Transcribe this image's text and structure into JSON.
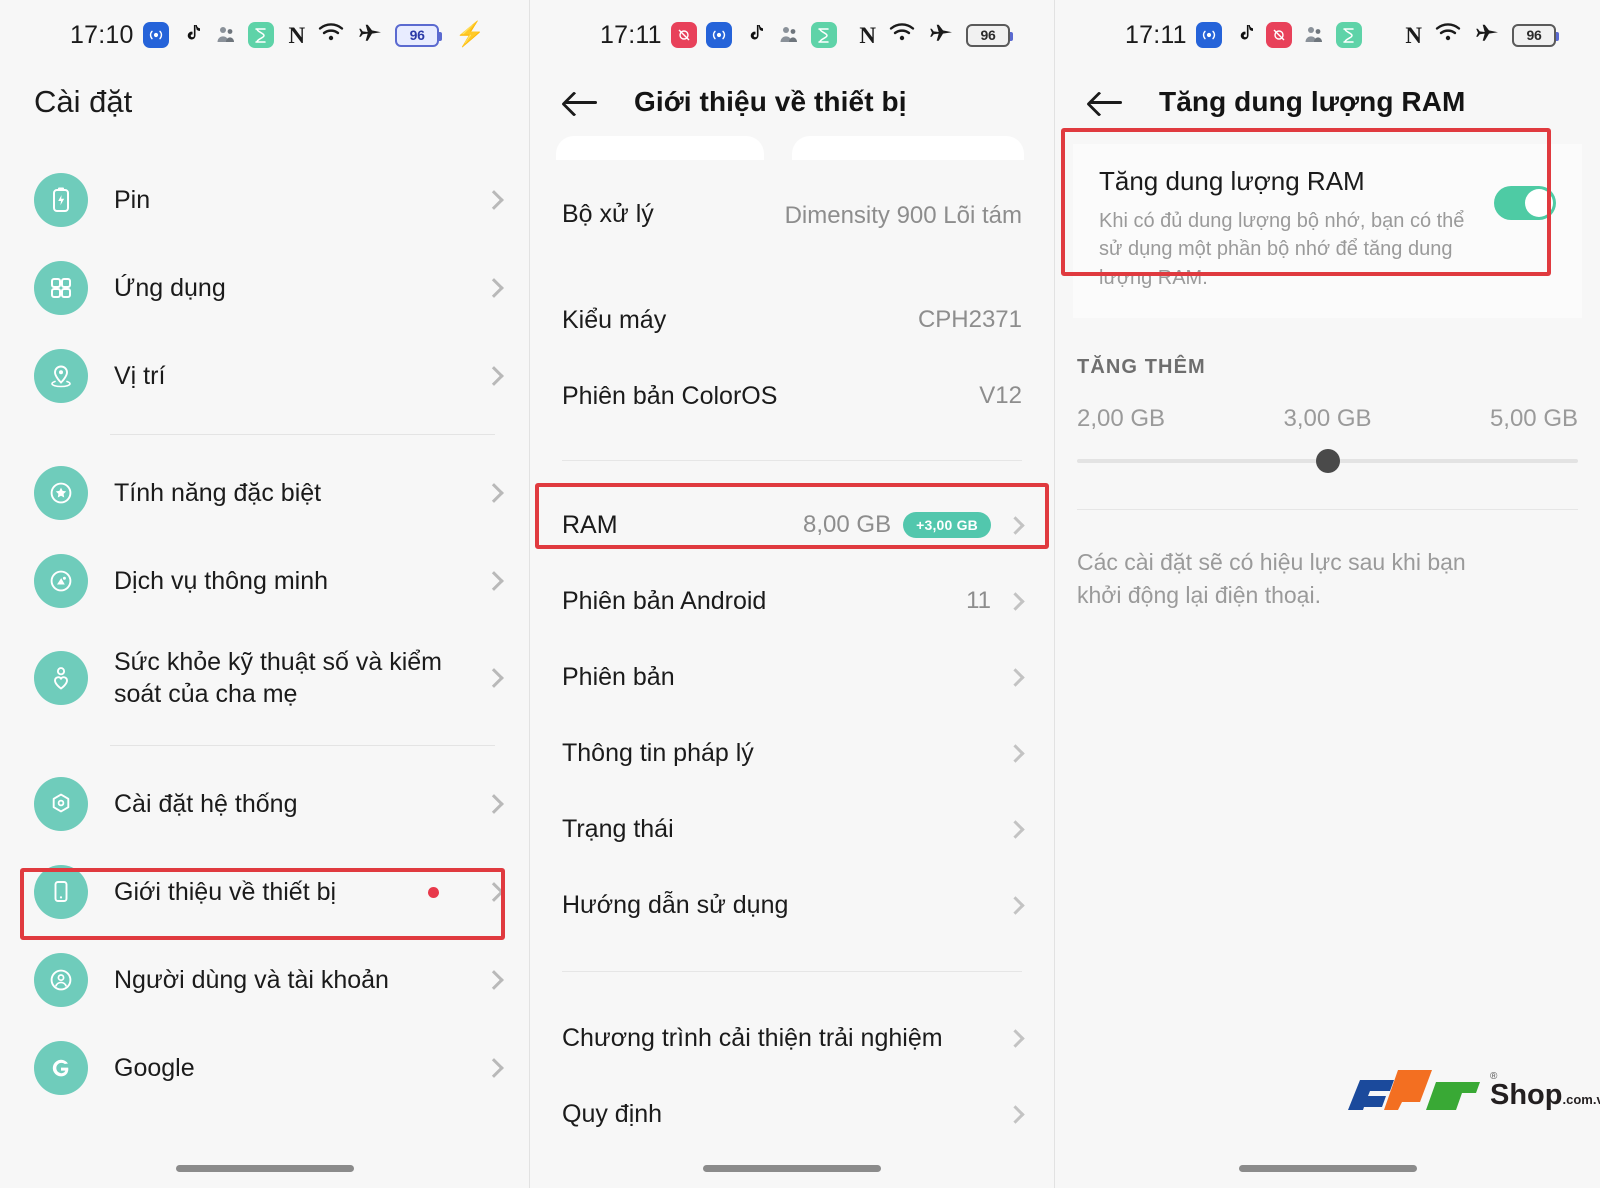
{
  "panels": [
    {
      "status": {
        "time": "17:10",
        "app_icons": [
          "wifi-cast-icon",
          "tiktok-icon",
          "people-icon",
          "green-app-icon"
        ],
        "nfc": "N",
        "battery_percent": "96",
        "charging": true
      },
      "title": "Cài đặt",
      "items": [
        {
          "label": "Pin",
          "icon": "battery-icon"
        },
        {
          "label": "Ứng dụng",
          "icon": "apps-grid-icon"
        },
        {
          "label": "Vị trí",
          "icon": "location-pin-icon"
        },
        {
          "label": "Tính năng đặc biệt",
          "icon": "star-circle-icon"
        },
        {
          "label": "Dịch vụ thông minh",
          "icon": "smart-service-icon"
        },
        {
          "label": "Sức khỏe kỹ thuật số và kiểm soát của cha mẹ",
          "icon": "digital-wellbeing-icon"
        },
        {
          "label": "Cài đặt hệ thống",
          "icon": "system-settings-icon"
        },
        {
          "label": "Giới thiệu về thiết bị",
          "icon": "phone-icon",
          "dot": true,
          "highlighted": true
        },
        {
          "label": "Người dùng và tài khoản",
          "icon": "user-account-icon"
        },
        {
          "label": "Google",
          "icon": "google-icon"
        }
      ]
    },
    {
      "status": {
        "time": "17:11",
        "app_icons": [
          "red-app-icon",
          "wifi-cast-icon",
          "tiktok-icon",
          "people-icon",
          "green-app-icon"
        ],
        "nfc": "N",
        "battery_percent": "96",
        "charging": false
      },
      "title": "Giới thiệu về thiết bị",
      "rows": [
        {
          "label": "Bộ xử lý",
          "value": "Dimensity 900 Lõi tám",
          "chevron": false
        },
        {
          "label": "Kiểu máy",
          "value": "CPH2371",
          "chevron": false
        },
        {
          "label": "Phiên bản ColorOS",
          "value": "V12",
          "chevron": false
        },
        {
          "label": "RAM",
          "value": "8,00 GB",
          "badge": "+3,00 GB",
          "chevron": true,
          "highlighted": true
        },
        {
          "label": "Phiên bản Android",
          "value": "11",
          "chevron": true
        },
        {
          "label": "Phiên bản",
          "value": "",
          "chevron": true
        },
        {
          "label": "Thông tin pháp lý",
          "value": "",
          "chevron": true
        },
        {
          "label": "Trạng thái",
          "value": "",
          "chevron": true
        },
        {
          "label": "Hướng dẫn sử dụng",
          "value": "",
          "chevron": true
        },
        {
          "label": "Chương trình cải thiện trải nghiệm",
          "value": "",
          "chevron": true
        },
        {
          "label": "Quy định",
          "value": "",
          "chevron": true
        }
      ]
    },
    {
      "status": {
        "time": "17:11",
        "app_icons": [
          "wifi-cast-icon",
          "tiktok-icon",
          "red-app-icon",
          "people-icon",
          "green-app-icon"
        ],
        "nfc": "N",
        "battery_percent": "96",
        "charging": false
      },
      "title": "Tăng dung lượng RAM",
      "toggle_card": {
        "title": "Tăng dung lượng RAM",
        "description": "Khi có đủ dung lượng bộ nhớ, bạn có thể sử dụng một phần bộ nhớ để tăng dung lượng RAM.",
        "enabled": true
      },
      "section_label": "TĂNG THÊM",
      "slider": {
        "ticks": [
          "2,00 GB",
          "3,00 GB",
          "5,00 GB"
        ],
        "selected": "3,00 GB",
        "position_percent": 50
      },
      "note": "Các cài đặt sẽ có hiệu lực sau khi bạn khởi động lại điện thoại.",
      "watermark": {
        "brand": "FPT",
        "shop": "Shop",
        "domain": ".com.vn"
      }
    }
  ],
  "colors": {
    "accent_teal": "#6fccbb",
    "toggle_on": "#4ecba4",
    "badge": "#52c7ad",
    "highlight_red": "#e03a3f",
    "dot_red": "#e8394b"
  }
}
